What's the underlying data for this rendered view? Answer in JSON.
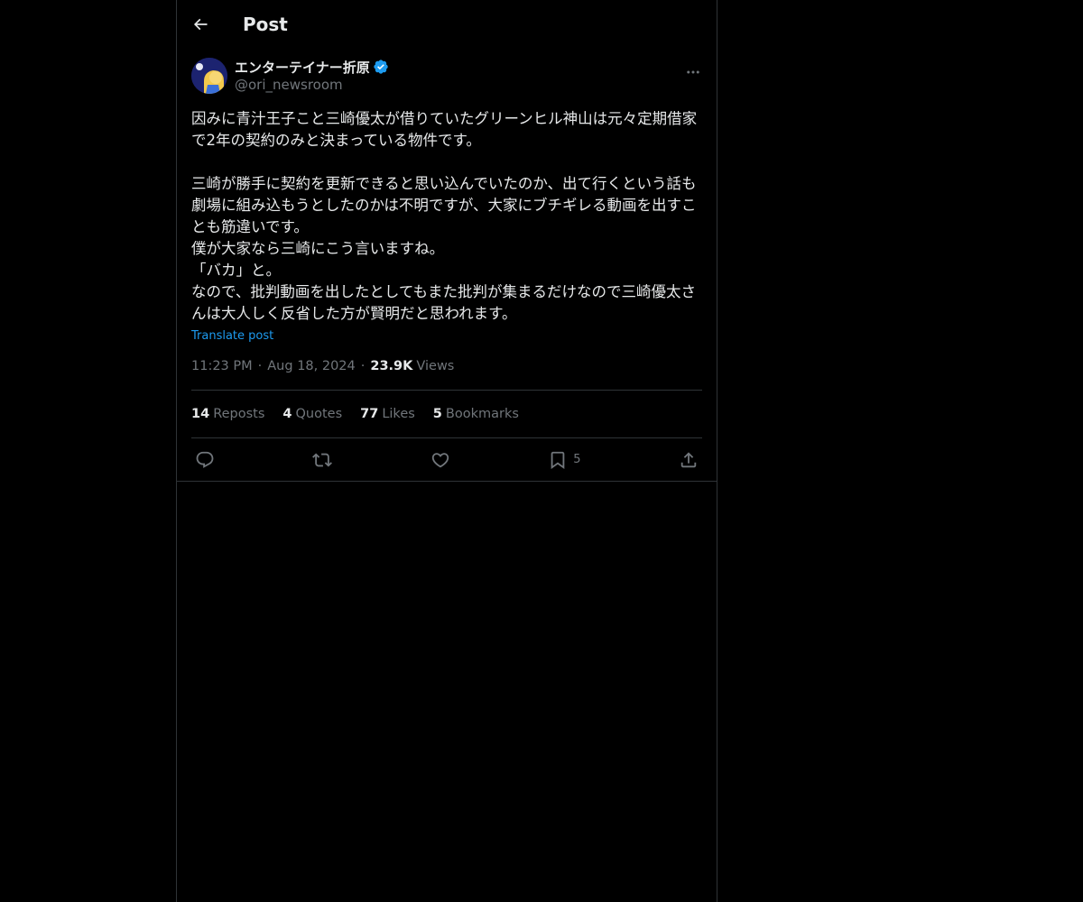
{
  "header": {
    "title": "Post"
  },
  "post": {
    "author": {
      "display_name": "エンターテイナー折原",
      "handle": "@ori_newsroom"
    },
    "body": "因みに青汁王子こと三崎優太が借りていたグリーンヒル神山は元々定期借家で2年の契約のみと決まっている物件です。\n\n三崎が勝手に契約を更新できると思い込んでいたのか、出て行くという話も劇場に組み込もうとしたのかは不明ですが、大家にブチギレる動画を出すことも筋違いです。\n僕が大家なら三崎にこう言いますね。\n「バカ」と。\nなので、批判動画を出したとしてもまた批判が集まるだけなので三崎優太さんは大人しく反省した方が賢明だと思われます。",
    "translate_label": "Translate post",
    "time": "11:23 PM",
    "date": "Aug 18, 2024",
    "views_count": "23.9K",
    "views_label": "Views",
    "separator": "·"
  },
  "stats": {
    "reposts_count": "14",
    "reposts_label": "Reposts",
    "quotes_count": "4",
    "quotes_label": "Quotes",
    "likes_count": "77",
    "likes_label": "Likes",
    "bookmarks_count": "5",
    "bookmarks_label": "Bookmarks"
  },
  "actions": {
    "bookmark_count": "5"
  },
  "colors": {
    "background": "#000000",
    "text": "#e7e9ea",
    "secondary": "#71767b",
    "accent": "#1d9bf0",
    "border": "#2f3336"
  },
  "icons": {
    "back": "arrow-left-icon",
    "verified": "verified-badge-icon",
    "more": "more-dots-icon",
    "reply": "reply-icon",
    "repost": "repost-icon",
    "like": "heart-icon",
    "bookmark": "bookmark-icon",
    "share": "share-icon"
  }
}
